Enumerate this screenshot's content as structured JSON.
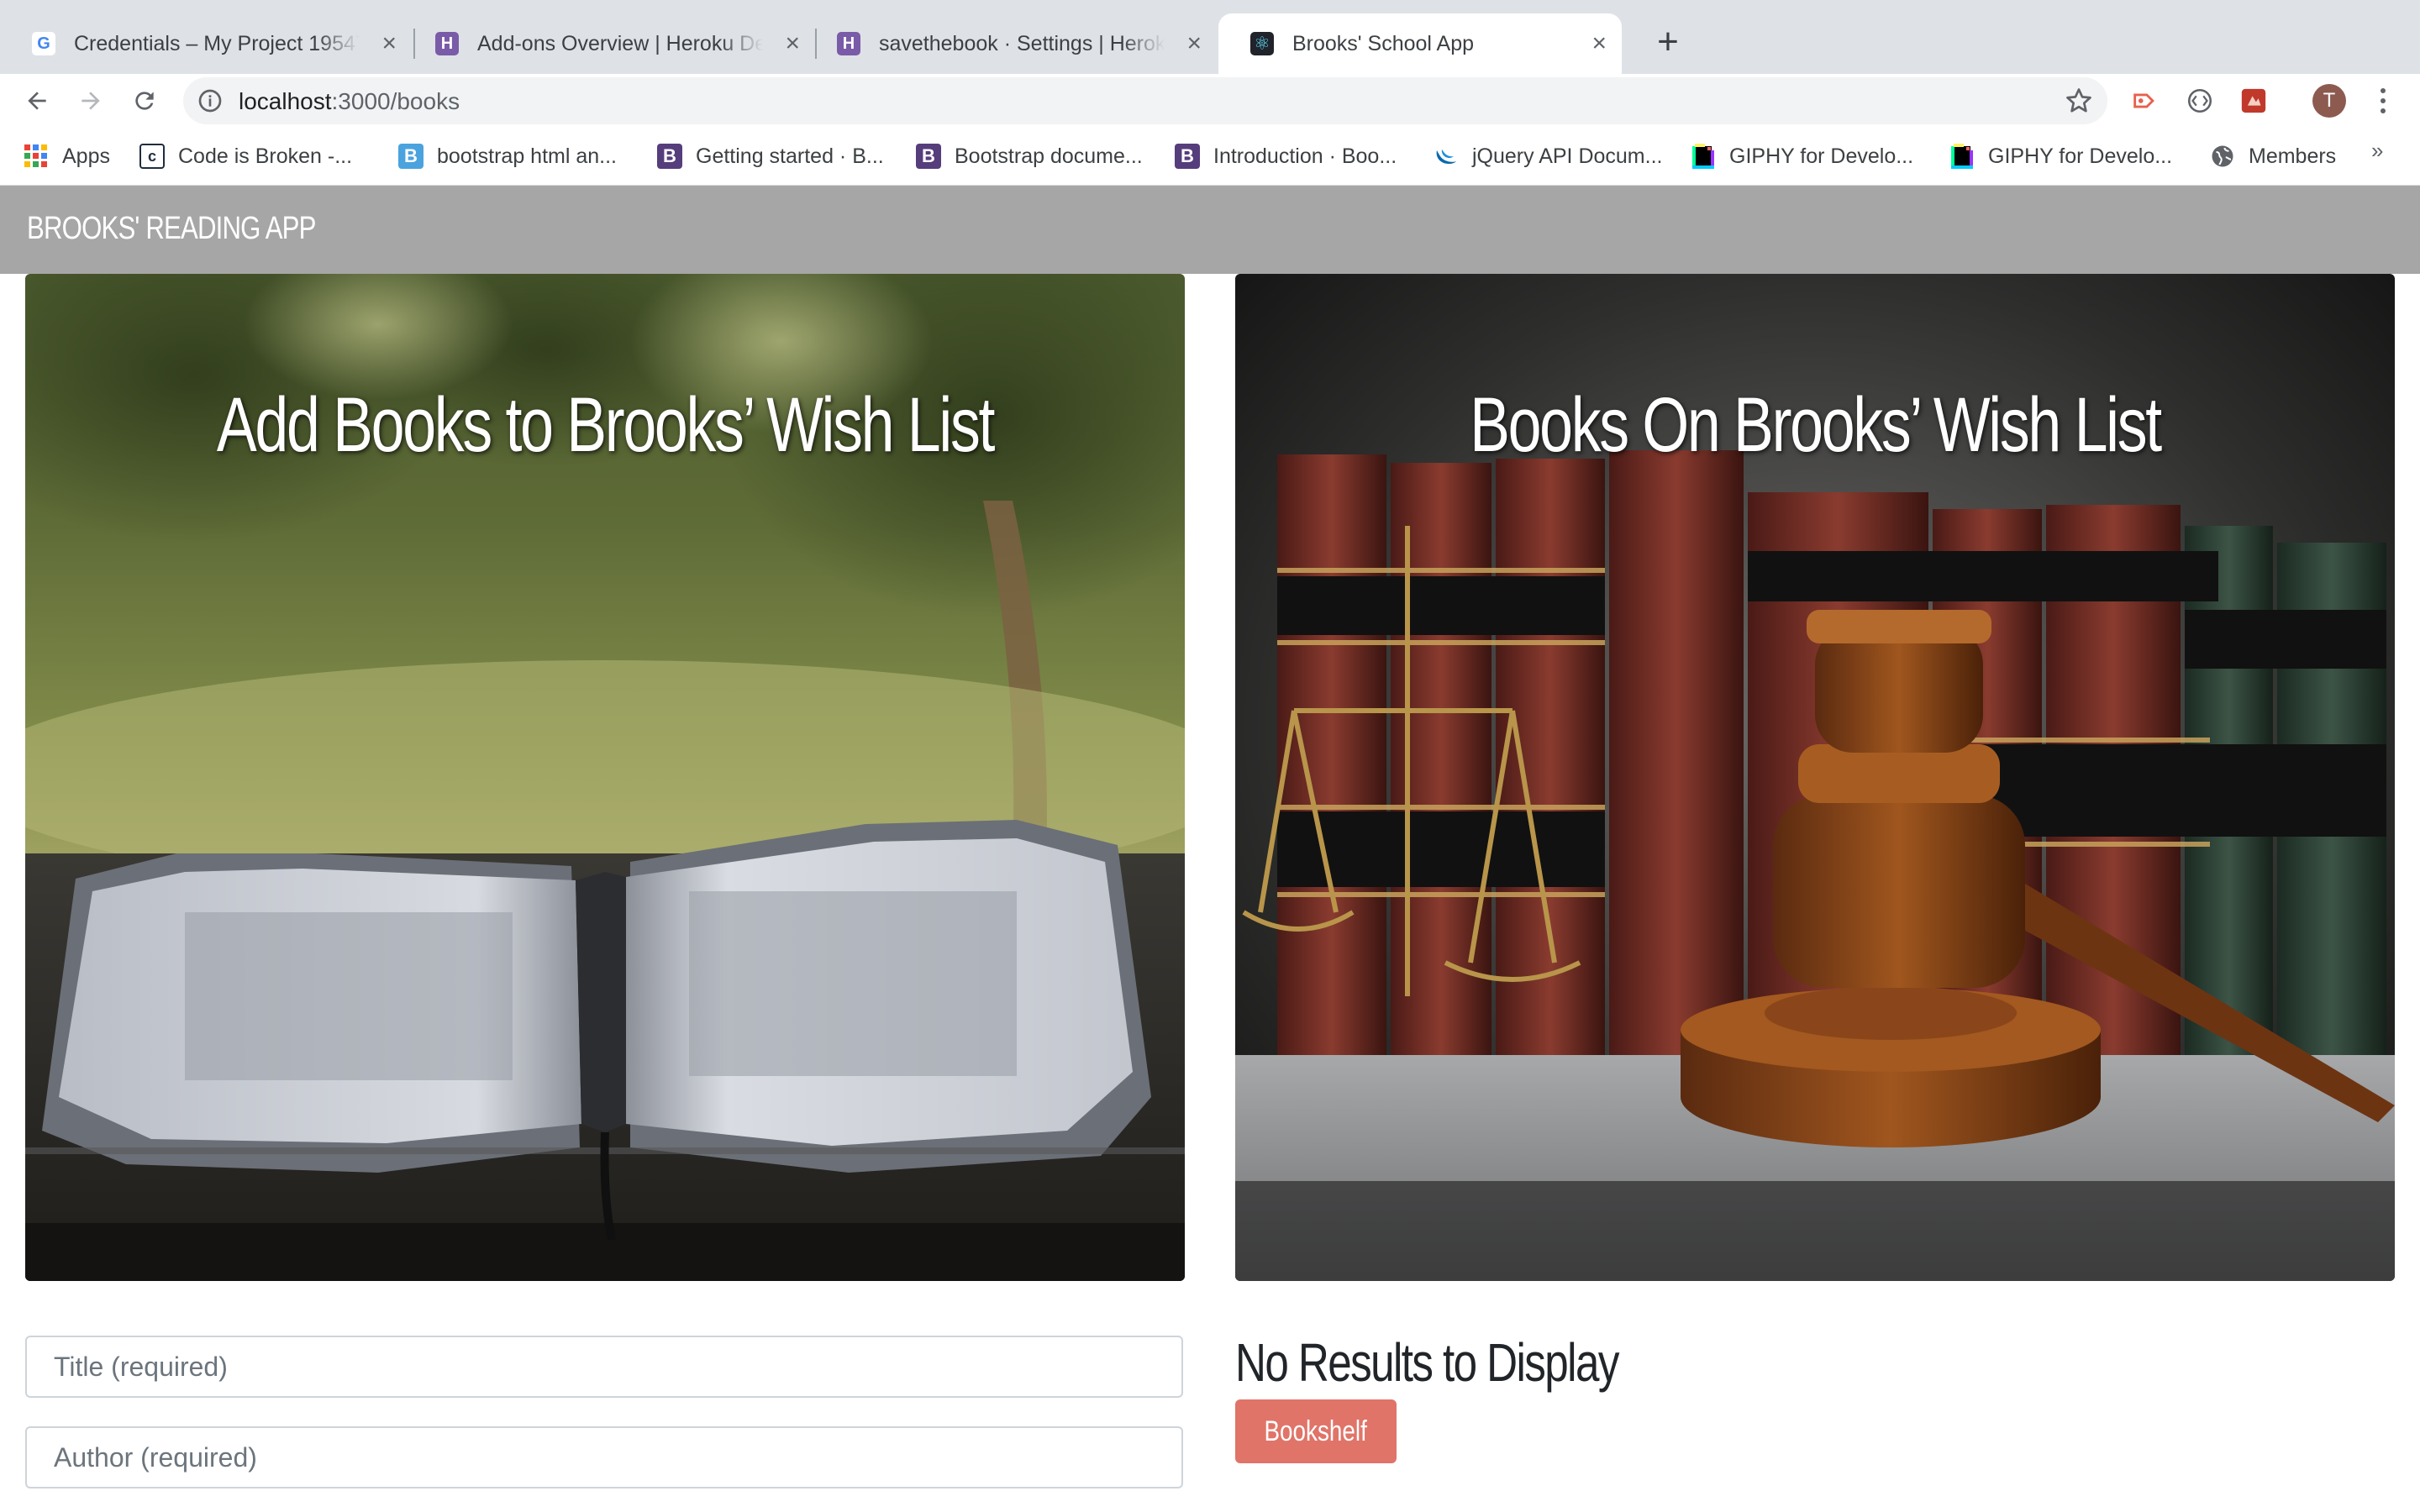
{
  "browser": {
    "tabs": [
      {
        "title": "Credentials – My Project 19547",
        "favicon": "google-icon"
      },
      {
        "title": "Add-ons Overview | Heroku De",
        "favicon": "heroku-icon"
      },
      {
        "title": "savethebook · Settings | Herok",
        "favicon": "heroku-icon"
      },
      {
        "title": "Brooks' School App",
        "favicon": "react-icon",
        "active": true
      }
    ],
    "url_host": "localhost",
    "url_path": ":3000/books",
    "bookmarks": [
      {
        "label": "Apps",
        "icon": "apps-grid-icon"
      },
      {
        "label": "Code is Broken -...",
        "icon": "code-icon"
      },
      {
        "label": "bootstrap html an...",
        "icon": "blue-b-icon"
      },
      {
        "label": "Getting started · B...",
        "icon": "bootstrap-icon"
      },
      {
        "label": "Bootstrap docume...",
        "icon": "bootstrap-icon"
      },
      {
        "label": "Introduction · Boo...",
        "icon": "bootstrap-icon"
      },
      {
        "label": "jQuery API Docum...",
        "icon": "jquery-icon"
      },
      {
        "label": "GIPHY for Develo...",
        "icon": "giphy-icon"
      },
      {
        "label": "GIPHY for Develo...",
        "icon": "giphy-icon"
      },
      {
        "label": "Members",
        "icon": "globe-icon"
      }
    ],
    "more_bookmarks": "»",
    "profile_initial": "T"
  },
  "app": {
    "brand": "BROOKS' READING APP",
    "left_heading": "Add Books to Brooks’ Wish List",
    "right_heading": "Books On Brooks’ Wish List",
    "title_placeholder": "Title (required)",
    "author_placeholder": "Author (required)",
    "no_results": "No Results to Display",
    "bookshelf_button": "Bookshelf"
  }
}
